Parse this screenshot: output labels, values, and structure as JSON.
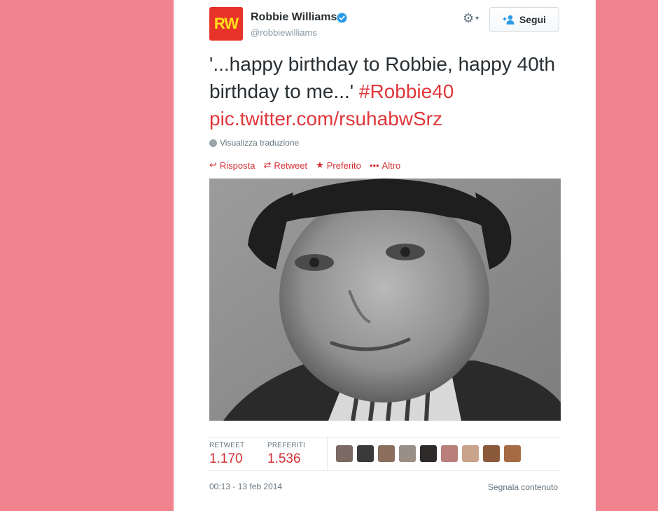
{
  "user": {
    "name": "Robbie Williams",
    "handle": "@robbiewilliams",
    "avatar_text": "RW"
  },
  "header": {
    "follow_label": "Segui"
  },
  "tweet": {
    "text_part1": "'...happy birthday to Robbie, happy 40th birthday to me...'",
    "hashtag": "#Robbie40",
    "link": "pic.twitter.com/rsuhabwSrz",
    "translate_label": "Visualizza traduzione"
  },
  "actions": {
    "reply": "Risposta",
    "retweet": "Retweet",
    "favorite": "Preferito",
    "more": "Altro"
  },
  "stats": {
    "retweets_label": "RETWEET",
    "retweets_value": "1.170",
    "favorites_label": "PREFERITI",
    "favorites_value": "1.536"
  },
  "faces": [
    "#7a6a63",
    "#3a3a3a",
    "#8a6f5c",
    "#9a8f86",
    "#2e2a2a",
    "#b97f7a",
    "#c9a48a",
    "#8b5a3a",
    "#a66b45"
  ],
  "footer": {
    "timestamp": "00:13 - 13 feb 2014",
    "report": "Segnala contenuto"
  },
  "colors": {
    "background": "#f0838e",
    "accent": "#d22f34",
    "verified": "#2b9be8"
  }
}
